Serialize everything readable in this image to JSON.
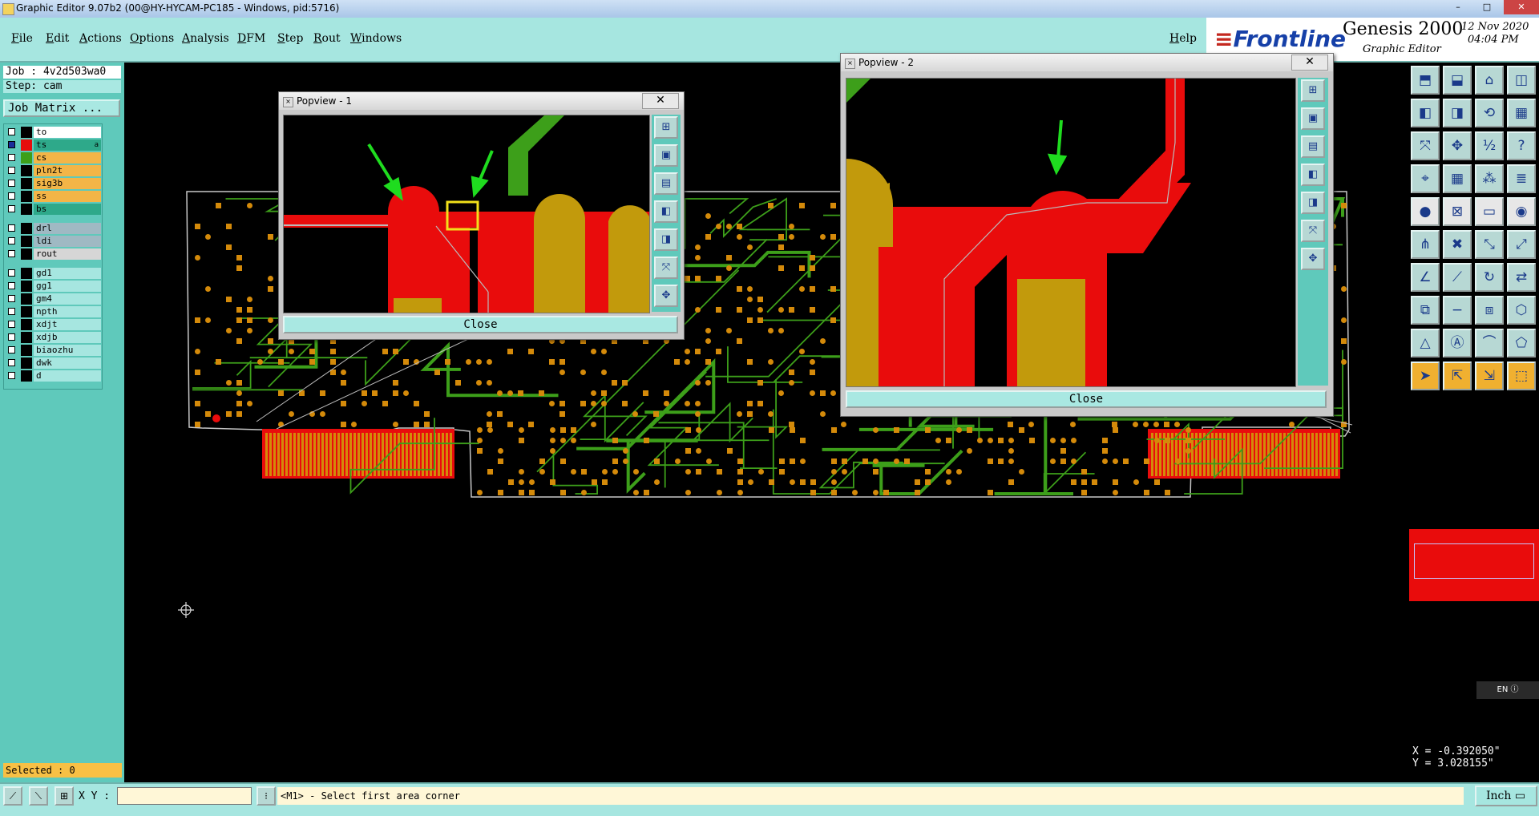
{
  "window": {
    "title": "Graphic Editor 9.07b2 (00@HY-HYCAM-PC185 - Windows, pid:5716)",
    "controls": [
      "–",
      "□",
      "✕"
    ]
  },
  "menu": {
    "items": [
      "File",
      "Edit",
      "Actions",
      "Options",
      "Analysis",
      "DFM",
      "Step",
      "Rout",
      "Windows"
    ],
    "help": "Help"
  },
  "brand": {
    "logo": "Frontline",
    "product": "Genesis 2000",
    "subtitle": "Graphic Editor",
    "date": "12 Nov 2020",
    "time": "04:04 PM"
  },
  "job": {
    "job_label": "Job : 4v2d503wa0",
    "step_label": "Step: cam",
    "matrix_button": "Job Matrix ..."
  },
  "layers": [
    {
      "name": "to",
      "color": "#ffffff",
      "swatch": "#000000",
      "checked": false
    },
    {
      "name": "ts",
      "color": "#2ea98a",
      "swatch": "#e60d0d",
      "checked": true,
      "marker": "a"
    },
    {
      "name": "cs",
      "color": "#f3b547",
      "swatch": "#3d9f1a",
      "checked": false
    },
    {
      "name": "pln2t",
      "color": "#f3b547",
      "swatch": "#000000",
      "checked": false
    },
    {
      "name": "sig3b",
      "color": "#f3b547",
      "swatch": "#000000",
      "checked": false
    },
    {
      "name": "ss",
      "color": "#f3b547",
      "swatch": "#000000",
      "checked": false
    },
    {
      "name": "bs",
      "color": "#2ea98a",
      "swatch": "#000000",
      "checked": false
    },
    {
      "name": "drl",
      "color": "#9fb9c3",
      "swatch": "#000000",
      "checked": false
    },
    {
      "name": "ldi",
      "color": "#9fb9c3",
      "swatch": "#000000",
      "checked": false
    },
    {
      "name": "rout",
      "color": "#d6d6d6",
      "swatch": "#000000",
      "checked": false
    },
    {
      "name": "gd1",
      "color": "#a6e6e0",
      "swatch": "#000000",
      "checked": false
    },
    {
      "name": "gg1",
      "color": "#a6e6e0",
      "swatch": "#000000",
      "checked": false
    },
    {
      "name": "gm4",
      "color": "#a6e6e0",
      "swatch": "#000000",
      "checked": false
    },
    {
      "name": "npth",
      "color": "#a6e6e0",
      "swatch": "#000000",
      "checked": false
    },
    {
      "name": "xdjt",
      "color": "#a6e6e0",
      "swatch": "#000000",
      "checked": false
    },
    {
      "name": "xdjb",
      "color": "#a6e6e0",
      "swatch": "#000000",
      "checked": false
    },
    {
      "name": "biaozhu",
      "color": "#a6e6e0",
      "swatch": "#000000",
      "checked": false
    },
    {
      "name": "dwk",
      "color": "#a6e6e0",
      "swatch": "#000000",
      "checked": false
    },
    {
      "name": "d",
      "color": "#a6e6e0",
      "swatch": "#000000",
      "checked": false
    }
  ],
  "selected": "Selected : 0",
  "popup1": {
    "title": "Popview - 1",
    "close_label": "Close",
    "close_x": "✕"
  },
  "popup2": {
    "title": "Popview - 2",
    "close_label": "Close",
    "close_x": "✕"
  },
  "bottom": {
    "xy_label": "X Y :",
    "xy_value": "",
    "message": "<M1> - Select first area corner",
    "units": "Inch"
  },
  "coords": {
    "x": "X = -0.392050\"",
    "y": "Y = 3.028155\""
  },
  "ime": "EN",
  "colors": {
    "panel": "#5fc9bb",
    "menubar": "#a6e6e0",
    "copper_red": "#e90c0c",
    "copper_green": "#3d9f1a",
    "pad_gold": "#c29a0c",
    "pad_orange": "#d48a0a"
  },
  "toolbar_icons": [
    "zoom-home-icon",
    "zoom-in-icon",
    "home-icon",
    "fit-window-icon",
    "pan-left-icon",
    "pan-right-icon",
    "redraw-icon",
    "zoom-area-icon",
    "fit-all-icon",
    "center-icon",
    "scale-1-2-icon",
    "help-icon",
    "measure-icon",
    "grid-icon",
    "snap-icon",
    "layers-icon",
    "pad-icon",
    "delete-icon",
    "ruler-icon",
    "circle-icon",
    "move-icon",
    "cross-icon",
    "connect-icon",
    "link-icon",
    "line-icon",
    "slash-icon",
    "rotate-icon",
    "flip-icon",
    "copy-icon",
    "minus-icon",
    "frame-icon",
    "node-icon",
    "triangle-a-icon",
    "arrow-a-icon",
    "arc-icon",
    "polygon-icon",
    "pointer-icon",
    "select-icon",
    "select-add-icon",
    "select-area-icon"
  ]
}
